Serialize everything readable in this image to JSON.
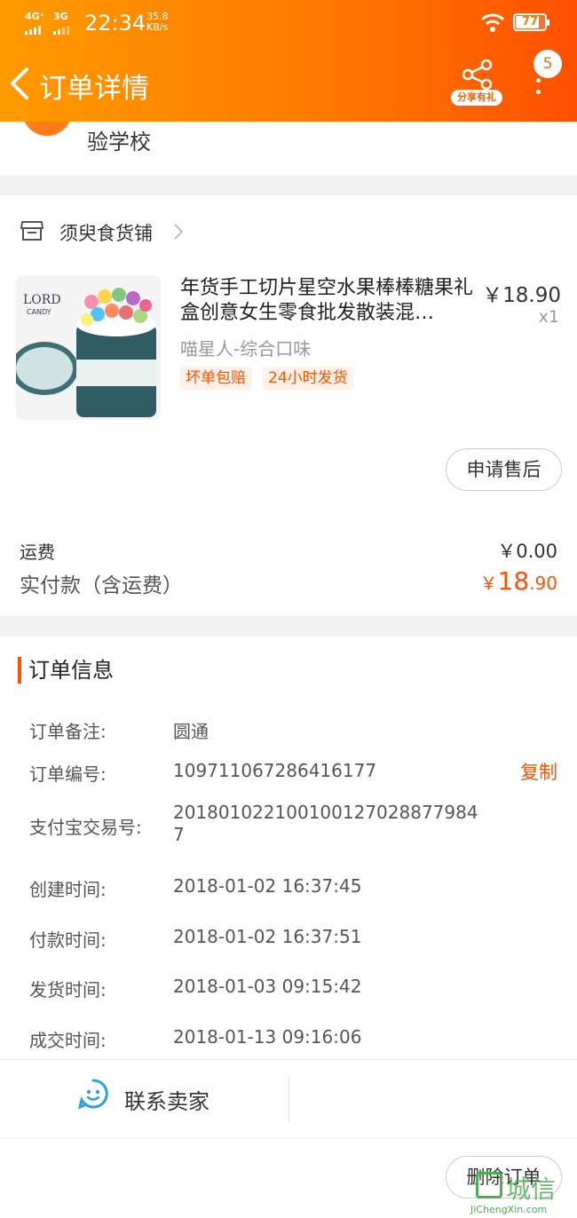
{
  "status_bar": {
    "sim1": "4G⁺",
    "sim2": "3G",
    "time": "22:34",
    "speed_value": "35.8",
    "speed_unit": "KB/s",
    "battery": "77",
    "battery_level": 0.77
  },
  "header": {
    "title": "订单详情",
    "share_label": "分享有礼",
    "badge_count": "5",
    "back_icon": "back-arrow-icon",
    "share_icon": "share-icon",
    "more_icon": "more-vertical-icon"
  },
  "address": {
    "line_tail": "验学校"
  },
  "shop": {
    "name": "须臾食货铺",
    "store_icon": "store-icon"
  },
  "product": {
    "name": "年货手工切片星空水果棒棒糖果礼盒创意女生零食批发散装混…",
    "price": "￥18.90",
    "quantity": "x1",
    "sku": "喵星人-综合口味",
    "tags": [
      "坏单包赔",
      "24小时发货"
    ],
    "image_text_brand": "LORD",
    "image_text_sub": "CANDY",
    "after_sale_button": "申请售后"
  },
  "fees": {
    "shipping_label": "运费",
    "shipping_value": "￥0.00",
    "paid_label": "实付款（含运费）",
    "paid_currency": "￥",
    "paid_integer": "18",
    "paid_decimal": ".90"
  },
  "order_info": {
    "title": "订单信息",
    "rows": [
      {
        "label": "订单备注:",
        "value": "圆通"
      },
      {
        "label": "订单编号:",
        "value": "109711067286416177"
      },
      {
        "label": "支付宝交易号:",
        "value": "20180102210010012702887798447"
      },
      {
        "label": "创建时间:",
        "value": "2018-01-02 16:37:45"
      },
      {
        "label": "付款时间:",
        "value": "2018-01-02 16:37:51"
      },
      {
        "label": "发货时间:",
        "value": "2018-01-03 09:15:42"
      },
      {
        "label": "成交时间:",
        "value": "2018-01-13 09:16:06"
      }
    ],
    "alipay_line1": "201801022100100127028877984",
    "alipay_line2": "7",
    "copy_label": "复制"
  },
  "contact": {
    "label": "联系卖家",
    "icon": "chat-smile-icon"
  },
  "bottom": {
    "delete_button": "删除订单"
  },
  "watermark": {
    "brand": "城信",
    "url": "JiChengXin.com"
  },
  "colors": {
    "accent": "#ff5000",
    "header_start": "#ff9a00",
    "header_end": "#ff5000"
  }
}
